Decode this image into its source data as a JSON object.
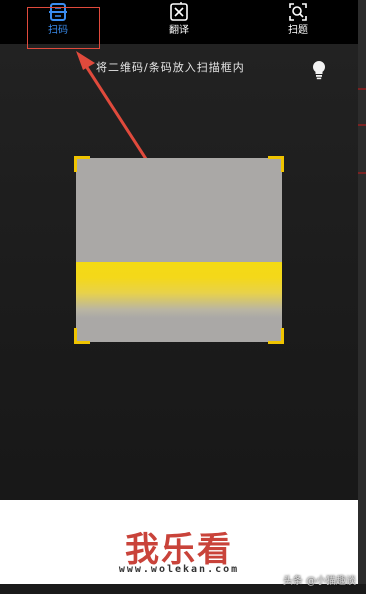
{
  "tabs": [
    {
      "label": "扫码",
      "icon": "scan-code-icon",
      "active": true
    },
    {
      "label": "翻译",
      "icon": "translate-icon",
      "active": false
    },
    {
      "label": "扫题",
      "icon": "scan-question-icon",
      "active": false
    }
  ],
  "scanner": {
    "hint": "将二维码/条码放入扫描框内",
    "flashlight_icon": "flashlight-bulb-icon"
  },
  "watermark": {
    "logo": "我乐看",
    "url": "www.wolekan.com"
  },
  "credit": "头条 @小猫趣谈",
  "colors": {
    "accent": "#3a8df0",
    "annotation": "#e04a3c",
    "scan_corner": "#f0c400",
    "scan_line": "#f3da14"
  }
}
